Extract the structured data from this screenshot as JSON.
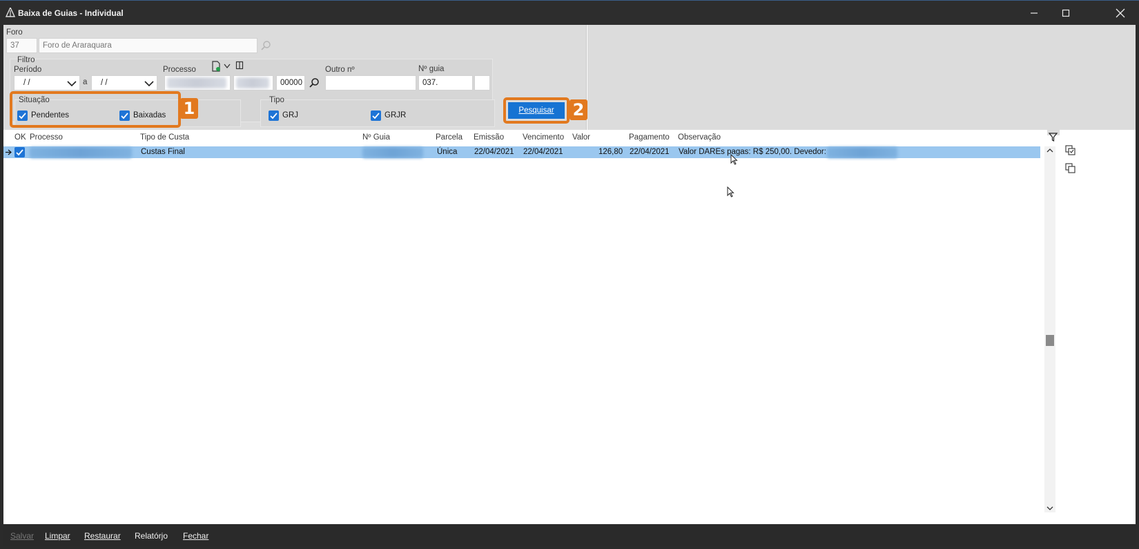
{
  "window": {
    "title": "Baixa de Guias - Individual",
    "controls": {
      "minimize": "—",
      "maximize": "☐",
      "close": "✕"
    }
  },
  "foro": {
    "label": "Foro",
    "code": "37",
    "name": "Foro de Araraquara"
  },
  "filtro": {
    "label": "Filtro",
    "periodo_label": "Período",
    "periodo_from": "/ /",
    "periodo_sep": "a",
    "periodo_to": "/ /",
    "processo_label": "Processo",
    "processo_suffix": "00000",
    "outro_label": "Outro nº",
    "outro_value": "",
    "guia_label": "Nº guia",
    "guia_value": "037."
  },
  "situacao": {
    "title": "Situação",
    "pendentes": {
      "label": "Pendentes",
      "checked": true
    },
    "baixadas": {
      "label": "Baixadas",
      "checked": true
    }
  },
  "tipo": {
    "title": "Tipo",
    "grj": {
      "label": "GRJ",
      "checked": true
    },
    "grjr": {
      "label": "GRJR",
      "checked": true
    }
  },
  "annotations": {
    "badge1": "1",
    "badge2": "2"
  },
  "search_button": "Pesquisar",
  "grid": {
    "headers": [
      "OK",
      "Processo",
      "Tipo de Custa",
      "Nº Guia",
      "Parcela",
      "Emissão",
      "Vencimento",
      "Valor",
      "Pagamento",
      "Observação"
    ],
    "rows": [
      {
        "ok": true,
        "tipo_custa": "Custas Final",
        "parcela": "Única",
        "emissao": "22/04/2021",
        "vencimento": "22/04/2021",
        "valor": "126,80",
        "pagamento": "22/04/2021",
        "observacao": "Valor DAREs pagas: R$ 250,00. Devedor:"
      }
    ]
  },
  "footer": {
    "salvar": "Salvar",
    "limpar": "Limpar",
    "restaurar": "Restaurar",
    "relatorio": "Relatórjo",
    "fechar": "Fechar"
  },
  "colors": {
    "accent": "#1673d3",
    "annotation": "#e2791f",
    "selected_row": "#9ac7ef",
    "panel": "#dcdcdc"
  }
}
